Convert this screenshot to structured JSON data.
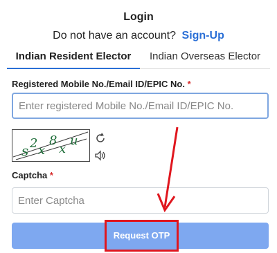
{
  "header": {
    "title": "Login",
    "no_account_text": "Do not have an account?",
    "signup_label": "Sign-Up"
  },
  "tabs": [
    {
      "label": "Indian Resident Elector",
      "active": true
    },
    {
      "label": "Indian Overseas Elector",
      "active": false
    }
  ],
  "login_field": {
    "label": "Registered Mobile No./Email ID/EPIC No.",
    "required_mark": "*",
    "placeholder": "Enter registered Mobile No./Email ID/EPIC No.",
    "value": ""
  },
  "captcha": {
    "image_text": "s2x8xu",
    "refresh_icon": "refresh-icon",
    "audio_icon": "speaker-icon"
  },
  "captcha_field": {
    "label": "Captcha",
    "required_mark": "*",
    "placeholder": "Enter Captcha",
    "value": ""
  },
  "request_otp": {
    "label": "Request OTP"
  },
  "annotation": {
    "highlight_color": "#e0161e",
    "arrow_color": "#e0161e"
  },
  "colors": {
    "accent": "#2a6fd6",
    "button": "#7ea8f0",
    "required": "#d62b2b"
  }
}
